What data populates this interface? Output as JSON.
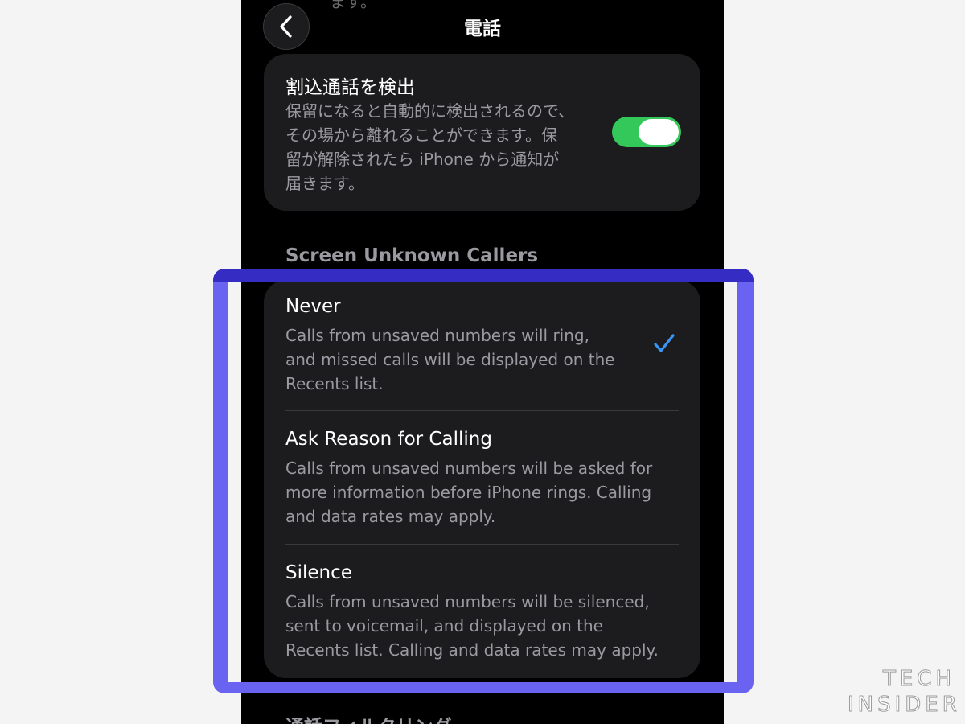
{
  "header": {
    "title": "電話",
    "back_icon": "chevron-left-icon",
    "cut_text": "ます。"
  },
  "hold_detection": {
    "title": "割込通話を検出",
    "description_lines": [
      "保留になると自動的に検出されるので、",
      "その場から離れることができます。保",
      "留が解除されたら iPhone から通知が",
      "届きます。"
    ],
    "toggle_on": true,
    "toggle_color": "#34c759"
  },
  "screen_unknown_callers": {
    "header": "Screen Unknown Callers",
    "options": [
      {
        "title": "Never",
        "description_lines": [
          "Calls from unsaved numbers will ring,",
          "and missed calls will be displayed on the",
          "Recents list."
        ],
        "selected": true
      },
      {
        "title": "Ask Reason for Calling",
        "description_lines": [
          "Calls from unsaved numbers will be asked for",
          "more information before iPhone rings. Calling",
          "and data rates may apply."
        ],
        "selected": false
      },
      {
        "title": "Silence",
        "description_lines": [
          "Calls from unsaved numbers will be silenced,",
          "sent to voicemail, and displayed on the",
          "Recents list. Calling and data rates may apply."
        ],
        "selected": false
      }
    ],
    "check_color": "#3a96f5"
  },
  "next_section_header": "通話フィルタリング",
  "highlight_color": "#6a63f2",
  "logo": {
    "line1": "TECH",
    "line2": "INSIDER"
  }
}
